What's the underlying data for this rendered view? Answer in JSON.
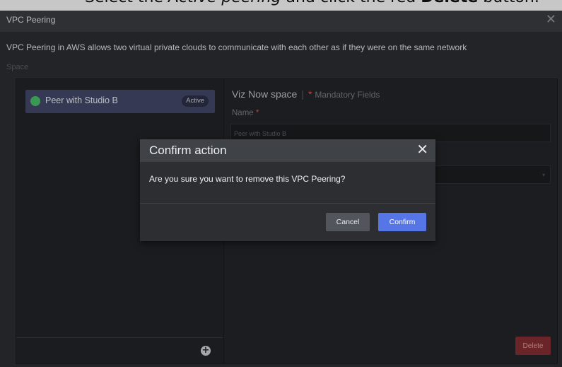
{
  "caption": {
    "prefix": "Select the ",
    "em": "Active peering",
    "middle": " and click the red ",
    "bold": "Delete",
    "suffix": " button."
  },
  "window": {
    "title": "VPC Peering",
    "close_glyph": "✕",
    "description": "VPC Peering in AWS allows two virtual private clouds to communicate with each other as if they were on the same network",
    "space_label": "Space"
  },
  "sidebar": {
    "items": [
      {
        "label": "Peer with Studio B",
        "badge": "Active",
        "status_color": "#4cc36a"
      }
    ],
    "add_glyph": "+"
  },
  "detail": {
    "title": "Viz Now space",
    "separator": "|",
    "required_mark": "*",
    "mandatory_text": "Mandatory Fields",
    "name_label": "Name",
    "name_value": "Peer with Studio B",
    "select_caret": "▾",
    "delete_label": "Delete"
  },
  "modal": {
    "title": "Confirm action",
    "close_glyph": "✕",
    "message": "Are you sure you want to remove this VPC Peering?",
    "cancel_label": "Cancel",
    "confirm_label": "Confirm"
  },
  "colors": {
    "accent": "#5776e6",
    "danger": "#8a2f33",
    "active_status": "#4cc36a"
  }
}
